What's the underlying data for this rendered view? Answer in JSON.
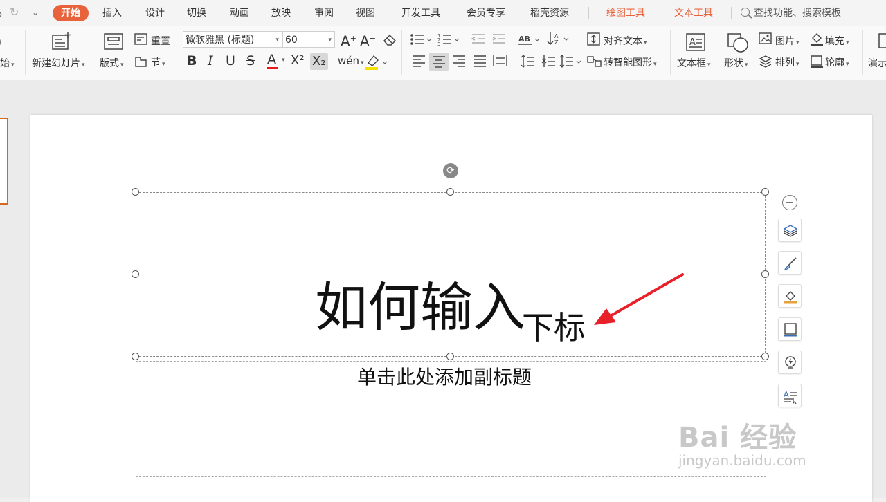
{
  "menubar": {
    "quick_access": [
      "↺",
      "↻",
      "⌄"
    ],
    "tabs": [
      "开始",
      "插入",
      "设计",
      "切换",
      "动画",
      "放映",
      "审阅",
      "视图",
      "开发工具",
      "会员专享",
      "稻壳资源",
      "绘图工具",
      "文本工具"
    ],
    "active_tab": "开始",
    "accent_tabs": [
      "绘图工具",
      "文本工具"
    ],
    "search_label": "查找功能、搜索模板"
  },
  "ribbon": {
    "partial_left_label": "始",
    "new_slide_label": "新建幻灯片",
    "layout_label": "版式",
    "reset_label": "重置",
    "section_label": "节",
    "font_name": "微软雅黑 (标题)",
    "font_size": "60",
    "bold": "B",
    "italic": "I",
    "underline": "U",
    "strike": "S",
    "font_color": "A",
    "superscript": "X²",
    "subscript": "X₂",
    "pinyin": "wén",
    "align_text_label": "对齐文本",
    "smartart_label": "转智能图形",
    "textbox_label": "文本框",
    "shape_label": "形状",
    "picture_label": "图片",
    "arrange_label": "排列",
    "fill_label": "填充",
    "outline_label": "轮廓",
    "partial_right_label": "演示"
  },
  "slide": {
    "title_main": "如何输入",
    "title_subscript": "下标",
    "subtitle_placeholder": "单击此处添加副标题"
  },
  "watermark": {
    "brand": "Bai 经验",
    "url": "jingyan.baidu.com"
  },
  "colors": {
    "accent": "#e8623c",
    "arrow": "#e8202a",
    "font_color_bar": "#e81818",
    "highlight_bar": "#f5e000"
  },
  "side_toolbar": [
    "collapse-icon",
    "layers-icon",
    "brush-icon",
    "fill-icon",
    "border-icon",
    "idea-icon",
    "text-effect-icon"
  ]
}
